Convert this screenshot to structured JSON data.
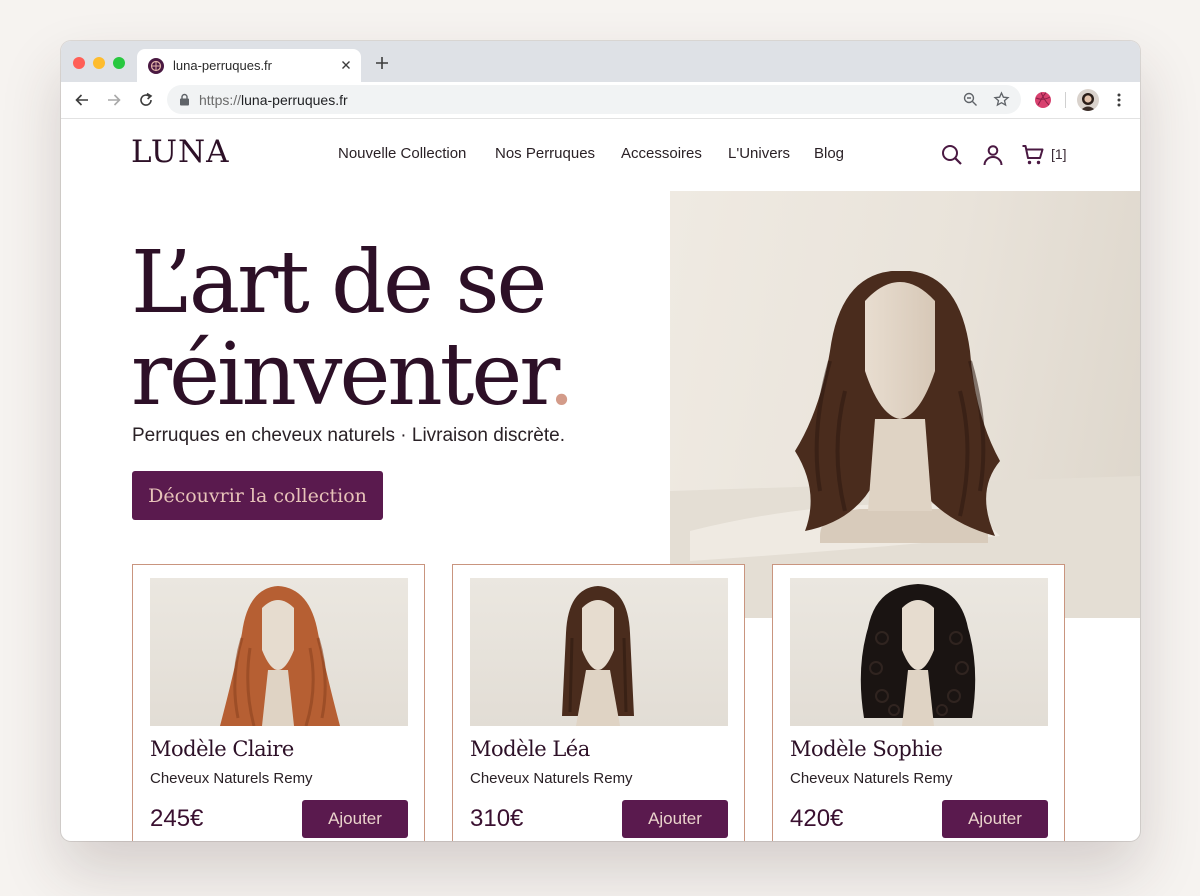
{
  "browser": {
    "tab_title": "luna-perruques.fr",
    "url_scheme": "https://",
    "url_host": "luna-perruques.fr"
  },
  "colors": {
    "brand_plum": "#5a1a4e",
    "heading": "#2d1027",
    "accent_rose": "#d39b89",
    "card_border": "#c9957f"
  },
  "header": {
    "logo": "LUNA",
    "nav": [
      "Nouvelle Collection",
      "Nos Perruques",
      "Accessoires",
      "L'Univers",
      "Blog"
    ],
    "cart_count": "[1]",
    "icons": [
      "search-icon",
      "account-icon",
      "cart-icon"
    ]
  },
  "hero": {
    "title_line1": "L’art de se",
    "title_line2": "réinventer",
    "title_dot": ".",
    "subtitle": "Perruques en cheveux naturels · Livraison discrète.",
    "cta": "Découvrir la collection"
  },
  "products": [
    {
      "name": "Modèle Claire",
      "desc": "Cheveux Naturels Remy",
      "price": "245€",
      "button": "Ajouter",
      "hair_color": "#b65f33"
    },
    {
      "name": "Modèle Léa",
      "desc": "Cheveux Naturels Remy",
      "price": "310€",
      "button": "Ajouter",
      "hair_color": "#4a2c1d"
    },
    {
      "name": "Modèle Sophie",
      "desc": "Cheveux Naturels Remy",
      "price": "420€",
      "button": "Ajouter",
      "hair_color": "#1a1412"
    }
  ]
}
